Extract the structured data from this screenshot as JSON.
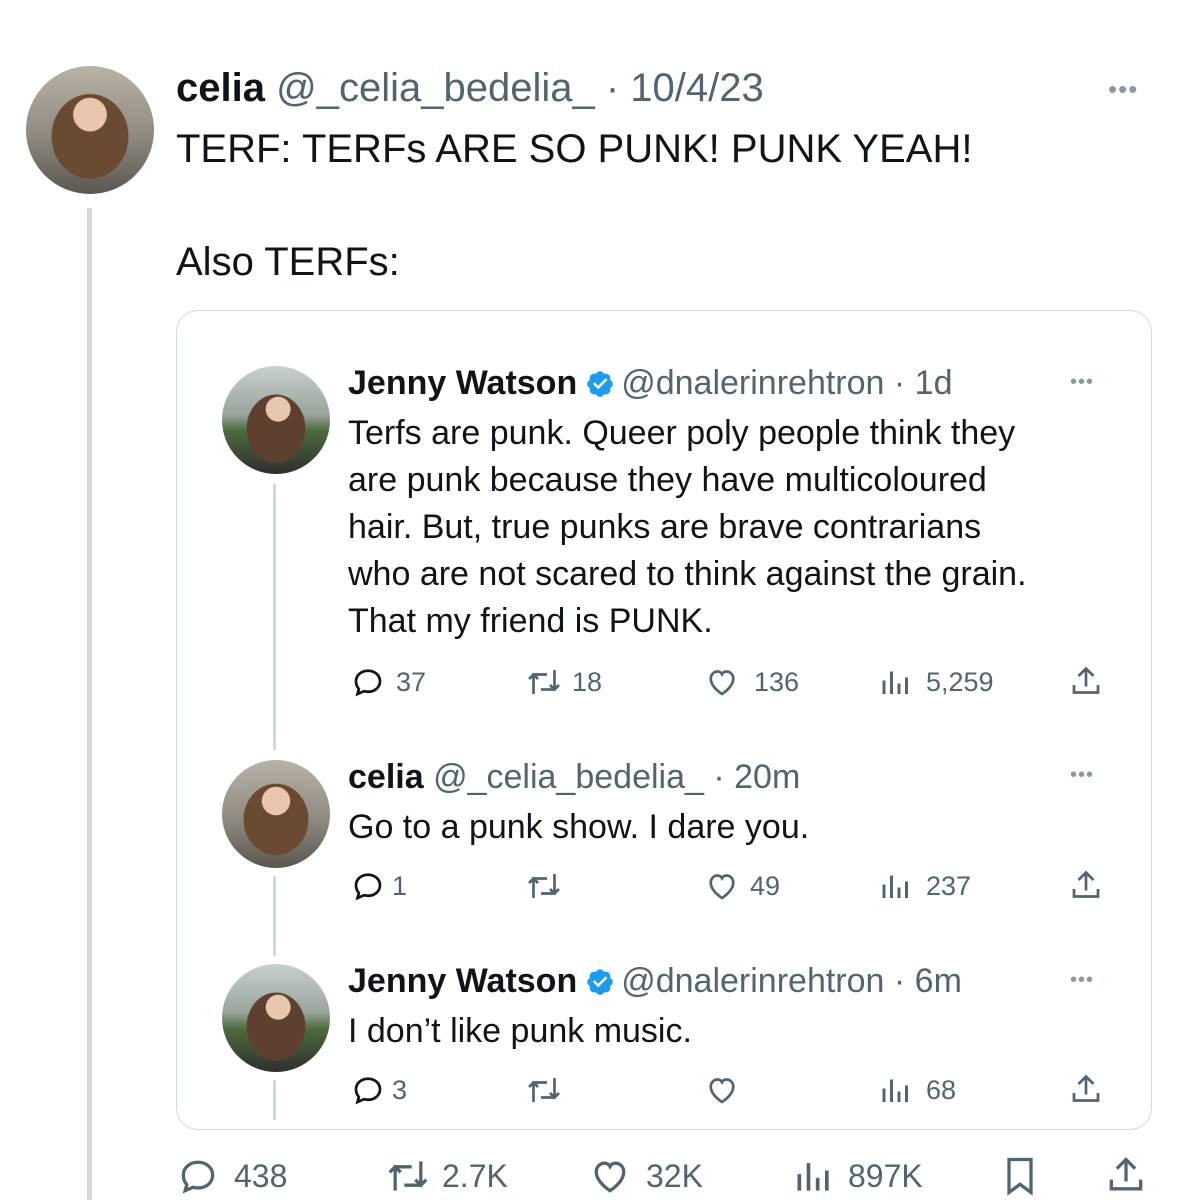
{
  "main_tweet": {
    "author": {
      "name": "celia",
      "handle": "@_celia_bedelia_",
      "time": "10/4/23"
    },
    "text_line1": "TERF: TERFs ARE SO PUNK! PUNK YEAH!",
    "text_line2": "Also TERFs:",
    "more": "•••",
    "actions": {
      "replies": "438",
      "retweets": "2.7K",
      "likes": "32K",
      "views": "897K"
    }
  },
  "quoted_thread": [
    {
      "author": {
        "name": "Jenny Watson",
        "handle": "@dnalerinrehtron",
        "time": "1d",
        "verified": true
      },
      "lines": [
        "Terfs are punk. Queer poly people think they",
        "are punk because they have multicoloured",
        "hair. But, true punks are brave contrarians",
        "who are not scared to think against the grain.",
        "That my friend is PUNK."
      ],
      "actions": {
        "replies": "37",
        "retweets": "18",
        "likes": "136",
        "views": "5,259"
      }
    },
    {
      "author": {
        "name": "celia",
        "handle": "@_celia_bedelia_",
        "time": "20m",
        "verified": false
      },
      "lines": [
        "Go to a punk show. I dare you."
      ],
      "actions": {
        "replies": "1",
        "retweets": "",
        "likes": "49",
        "views": "237"
      }
    },
    {
      "author": {
        "name": "Jenny Watson",
        "handle": "@dnalerinrehtron",
        "time": "6m",
        "verified": true
      },
      "lines": [
        "I don’t like punk music."
      ],
      "actions": {
        "replies": "3",
        "retweets": "",
        "likes": "",
        "views": "68"
      }
    }
  ],
  "colors": {
    "text": "#0f1419",
    "muted": "#536471",
    "verified": "#1d9bf0",
    "border": "#cfd9de"
  }
}
